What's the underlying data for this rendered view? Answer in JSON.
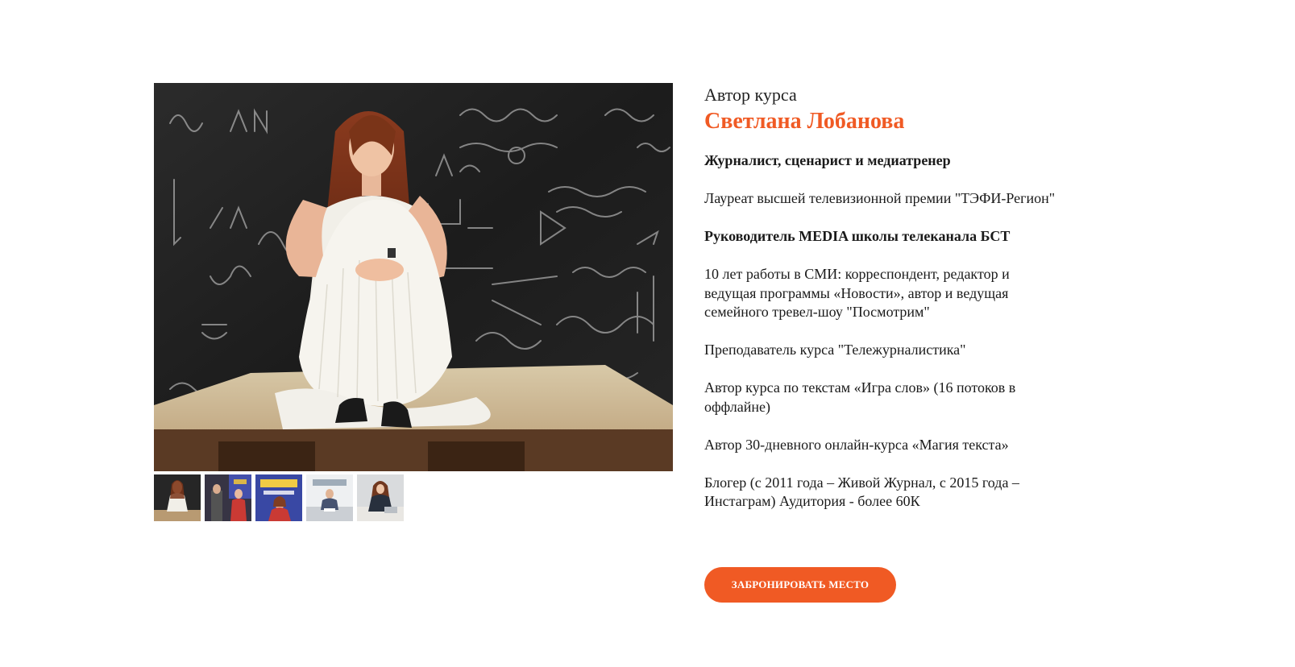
{
  "colors": {
    "accent": "#f05a24",
    "text": "#1a1a1a",
    "background": "#ffffff"
  },
  "gallery": {
    "main_photo_icon": "portrait-photo",
    "thumbnails": [
      {
        "icon": "thumbnail-photo",
        "active": true
      },
      {
        "icon": "thumbnail-photo",
        "active": false
      },
      {
        "icon": "thumbnail-photo",
        "active": false
      },
      {
        "icon": "thumbnail-photo",
        "active": false
      },
      {
        "icon": "thumbnail-photo",
        "active": false
      }
    ]
  },
  "author": {
    "label": "Автор курса",
    "name": "Светлана Лобанова",
    "items": [
      {
        "text": "Журналист, сценарист и медиатренер",
        "bold": true
      },
      {
        "text": "Лауреат высшей телевизионной премии \"ТЭФИ-Регион\"",
        "bold": false
      },
      {
        "text": "Руководитель MEDIA школы телеканала БСТ",
        "bold": true
      },
      {
        "text": "10 лет работы в СМИ: корреспондент, редактор и ведущая программы «Новости», автор и ведущая семейного тревел-шоу \"Посмотрим\"",
        "bold": false
      },
      {
        "text": "Преподаватель курса \"Тележурналистика\"",
        "bold": false
      },
      {
        "text": "Автор курса по текстам «Игра слов» (16 потоков в оффлайне)",
        "bold": false
      },
      {
        "text": "Автор 30-дневного онлайн-курса «Магия текста»",
        "bold": false
      },
      {
        "text": "Блогер (с 2011 года – Живой Журнал, с 2015 года – Инстаграм) Аудитория - более 60К",
        "bold": false
      }
    ]
  },
  "cta": {
    "label": "ЗАБРОНИРОВАТЬ МЕСТО"
  }
}
